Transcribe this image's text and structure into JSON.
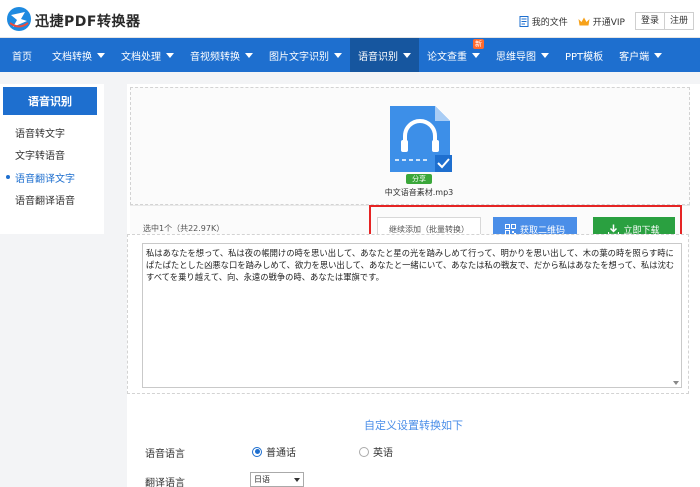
{
  "header": {
    "brand": "迅捷PDF转换器",
    "my_files": "我的文件",
    "vip": "开通VIP",
    "login": "登录",
    "register": "注册"
  },
  "nav": {
    "items": [
      {
        "label": "首页"
      },
      {
        "label": "文档转换"
      },
      {
        "label": "文档处理"
      },
      {
        "label": "音视频转换"
      },
      {
        "label": "图片文字识别"
      },
      {
        "label": "语音识别"
      },
      {
        "label": "论文查重"
      },
      {
        "label": "思维导图"
      },
      {
        "label": "PPT模板"
      },
      {
        "label": "客户端"
      }
    ],
    "new_badge": "新"
  },
  "sidebar": {
    "title": "语音识别",
    "items": [
      {
        "label": "语音转文字"
      },
      {
        "label": "文字转语音"
      },
      {
        "label": "语音翻译文字"
      },
      {
        "label": "语音翻译语音"
      }
    ]
  },
  "file": {
    "share": "分享",
    "name": "中文语音素材.mp3"
  },
  "status": {
    "selected": "选中1个（共22.97K）",
    "continue_btn": "继续添加（批量转换）",
    "qr_btn": "获取二维码",
    "download_btn": "立即下载"
  },
  "result": {
    "text": "私はあなたを想って、私は夜の帳開けの時を思い出して、あなたと星の光を踏みしめて行って、明かりを思い出して、木の葉の時を照らす時にぱたぱたとした凶悪な口を踏みしめて、欲力を思い出して、あなたと一緒にいて、あなたは私の戦友で、だから私はあなたを想って、私は沈むすべてを乗り越えて、向、永遠の戦争の時、あなたは軍旗です。"
  },
  "settings": {
    "title": "自定义设置转换如下",
    "voice_label": "语音语言",
    "option_mandarin": "普通话",
    "option_english": "英语",
    "translate_label": "翻译语言",
    "translate_value": "日语"
  },
  "colors": {
    "primary": "#1e6fcf",
    "nav_active": "#16569f",
    "download": "#2aa040",
    "qr": "#4a8ee8",
    "highlight": "#e52323"
  }
}
